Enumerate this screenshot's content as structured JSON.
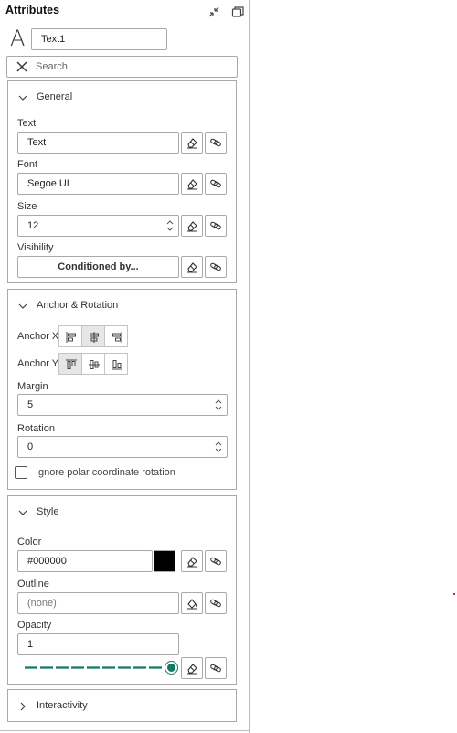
{
  "header": {
    "title": "Attributes"
  },
  "element": {
    "type_glyph": "A",
    "name": "Text1"
  },
  "search": {
    "placeholder": "Search"
  },
  "sections": {
    "general": {
      "title": "General",
      "text_label": "Text",
      "text_value": "Text",
      "font_label": "Font",
      "font_value": "Segoe UI",
      "size_label": "Size",
      "size_value": "12",
      "visibility_label": "Visibility",
      "visibility_button": "Conditioned by..."
    },
    "anchor": {
      "title": "Anchor & Rotation",
      "anchor_x_label": "Anchor X",
      "anchor_y_label": "Anchor Y",
      "margin_label": "Margin",
      "margin_value": "5",
      "rotation_label": "Rotation",
      "rotation_value": "0",
      "ignore_polar_label": "Ignore polar coordinate rotation",
      "ignore_polar_checked": false
    },
    "style": {
      "title": "Style",
      "color_label": "Color",
      "color_value": "#000000",
      "outline_label": "Outline",
      "outline_value": "(none)",
      "opacity_label": "Opacity",
      "opacity_value": "1",
      "opacity_slider_fraction": 1.0
    },
    "interactivity": {
      "title": "Interactivity"
    }
  },
  "colors": {
    "accent": "#147a63",
    "swatch": "#000000",
    "border": "#a9a9a9"
  }
}
